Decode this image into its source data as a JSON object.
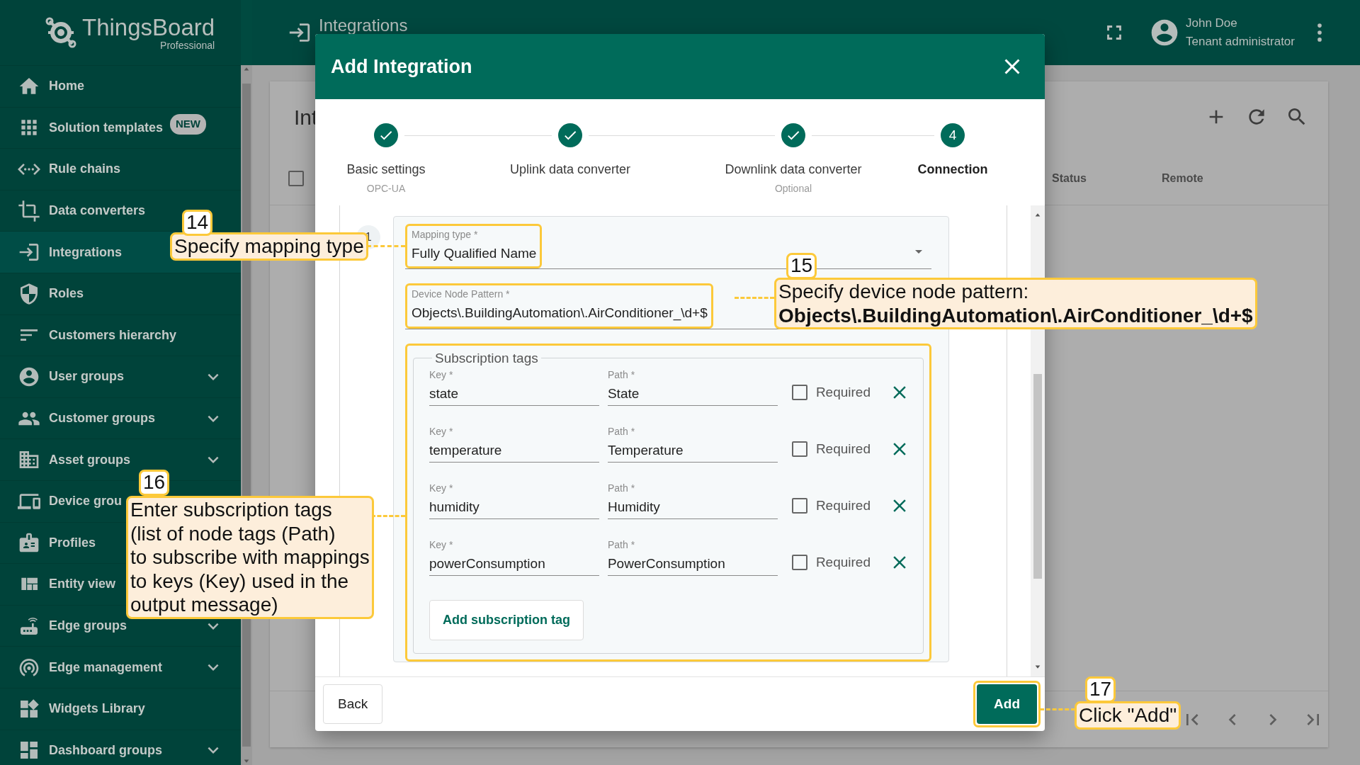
{
  "logo": {
    "name": "ThingsBoard",
    "edition": "Professional"
  },
  "sidebar": {
    "items": [
      {
        "label": "Home",
        "selected": false,
        "collapsible": false
      },
      {
        "label": "Solution templates",
        "selected": false,
        "collapsible": false,
        "badge": "NEW"
      },
      {
        "label": "Rule chains",
        "selected": false,
        "collapsible": false
      },
      {
        "label": "Data converters",
        "selected": false,
        "collapsible": false
      },
      {
        "label": "Integrations",
        "selected": true,
        "collapsible": false
      },
      {
        "label": "Roles",
        "selected": false,
        "collapsible": false
      },
      {
        "label": "Customers hierarchy",
        "selected": false,
        "collapsible": false
      },
      {
        "label": "User groups",
        "selected": false,
        "collapsible": true
      },
      {
        "label": "Customer groups",
        "selected": false,
        "collapsible": true
      },
      {
        "label": "Asset groups",
        "selected": false,
        "collapsible": true
      },
      {
        "label": "Device grou",
        "selected": false,
        "collapsible": false
      },
      {
        "label": "Profiles",
        "selected": false,
        "collapsible": false
      },
      {
        "label": "Entity view",
        "selected": false,
        "collapsible": false
      },
      {
        "label": "Edge groups",
        "selected": false,
        "collapsible": true
      },
      {
        "label": "Edge management",
        "selected": false,
        "collapsible": true
      },
      {
        "label": "Widgets Library",
        "selected": false,
        "collapsible": false
      },
      {
        "label": "Dashboard groups",
        "selected": false,
        "collapsible": true
      }
    ]
  },
  "top_bar": {
    "title": "Integrations",
    "user": {
      "name": "John Doe",
      "role": "Tenant administrator"
    }
  },
  "table": {
    "title": "Int",
    "select_all_checked": false,
    "columns": [
      "Status",
      "Remote"
    ]
  },
  "dialog": {
    "title": "Add Integration",
    "steps": [
      {
        "label": "Basic settings",
        "sublabel": "OPC-UA",
        "done": true,
        "selected": false
      },
      {
        "label": "Uplink data converter",
        "done": true,
        "selected": false
      },
      {
        "label": "Downlink data converter",
        "sublabel": "Optional",
        "done": true,
        "selected": false
      },
      {
        "label": "Connection",
        "number": "4",
        "done": false,
        "selected": true
      }
    ],
    "section_number": "1",
    "mapping_type": {
      "label": "Mapping type *",
      "value": "Fully Qualified Name"
    },
    "device_node_pattern": {
      "label": "Device Node Pattern *",
      "value": "Objects\\.BuildingAutomation\\.AirConditioner_\\d+$"
    },
    "subscription_tags": {
      "legend": "Subscription tags",
      "rows": [
        {
          "key_label": "Key *",
          "key": "state",
          "path_label": "Path *",
          "path": "State",
          "required_label": "Required",
          "required": false
        },
        {
          "key_label": "Key *",
          "key": "temperature",
          "path_label": "Path *",
          "path": "Temperature",
          "required_label": "Required",
          "required": false
        },
        {
          "key_label": "Key *",
          "key": "humidity",
          "path_label": "Path *",
          "path": "Humidity",
          "required_label": "Required",
          "required": false
        },
        {
          "key_label": "Key *",
          "key": "powerConsumption",
          "path_label": "Path *",
          "path": "PowerConsumption",
          "required_label": "Required",
          "required": false
        }
      ],
      "add_button": "Add subscription tag"
    },
    "buttons": {
      "back": "Back",
      "add": "Add"
    }
  },
  "callouts": [
    {
      "number": "14",
      "text": "Specify mapping type"
    },
    {
      "number": "15",
      "text": "Specify device node pattern:",
      "detail": "Objects\\.BuildingAutomation\\.AirConditioner_\\d+$"
    },
    {
      "number": "16",
      "text": "Enter subscription tags\n(list of node tags (Path)\nto subscribe with mappings\nto keys (Key) used in the\noutput message)"
    },
    {
      "number": "17",
      "text": "Click \"Add\""
    }
  ]
}
